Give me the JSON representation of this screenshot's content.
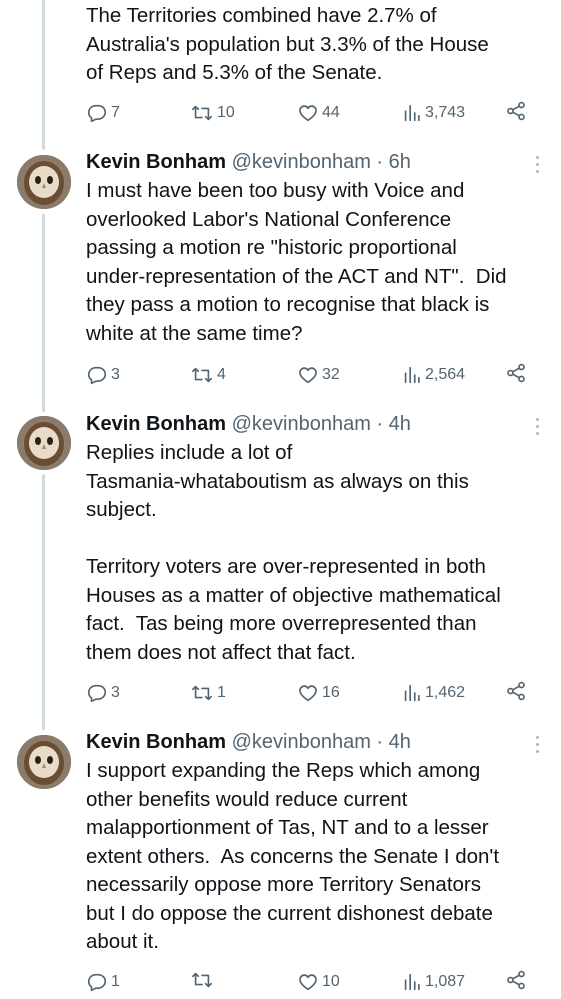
{
  "colors": {
    "text": "#0f1419",
    "muted": "#536471",
    "thread": "#cfd9de"
  },
  "tweets": [
    {
      "show_header": false,
      "text": "The Territories combined have 2.7% of\nAustralia's population but 3.3% of the House\nof Reps and 5.3% of the Senate.",
      "replies": "7",
      "retweets": "10",
      "likes": "44",
      "views": "3,743"
    },
    {
      "show_header": true,
      "name": "Kevin Bonham",
      "handle": "@kevinbonham",
      "time": " · 6h",
      "text": "I must have been too busy with Voice and\noverlooked Labor's National Conference\npassing a motion re \"historic proportional\nunder-representation of the ACT and NT\".  Did\nthey pass a motion to recognise that black is\nwhite at the same time?",
      "replies": "3",
      "retweets": "4",
      "likes": "32",
      "views": "2,564"
    },
    {
      "show_header": true,
      "name": "Kevin Bonham",
      "handle": "@kevinbonham",
      "time": " · 4h",
      "text": "Replies include a lot of\nTasmania-whataboutism as always on this\nsubject.\n\nTerritory voters are over-represented in both\nHouses as a matter of objective mathematical\nfact.  Tas being more overrepresented than\nthem does not affect that fact.",
      "replies": "3",
      "retweets": "1",
      "likes": "16",
      "views": "1,462"
    },
    {
      "show_header": true,
      "name": "Kevin Bonham",
      "handle": "@kevinbonham",
      "time": " · 4h",
      "text": "I support expanding the Reps which among\nother benefits would reduce current\nmalapportionment of Tas, NT and to a lesser\nextent others.  As concerns the Senate I don't\nnecessarily oppose more Territory Senators\nbut I do oppose the current dishonest debate\nabout it.",
      "replies": "1",
      "retweets": "",
      "likes": "10",
      "views": "1,087"
    }
  ]
}
